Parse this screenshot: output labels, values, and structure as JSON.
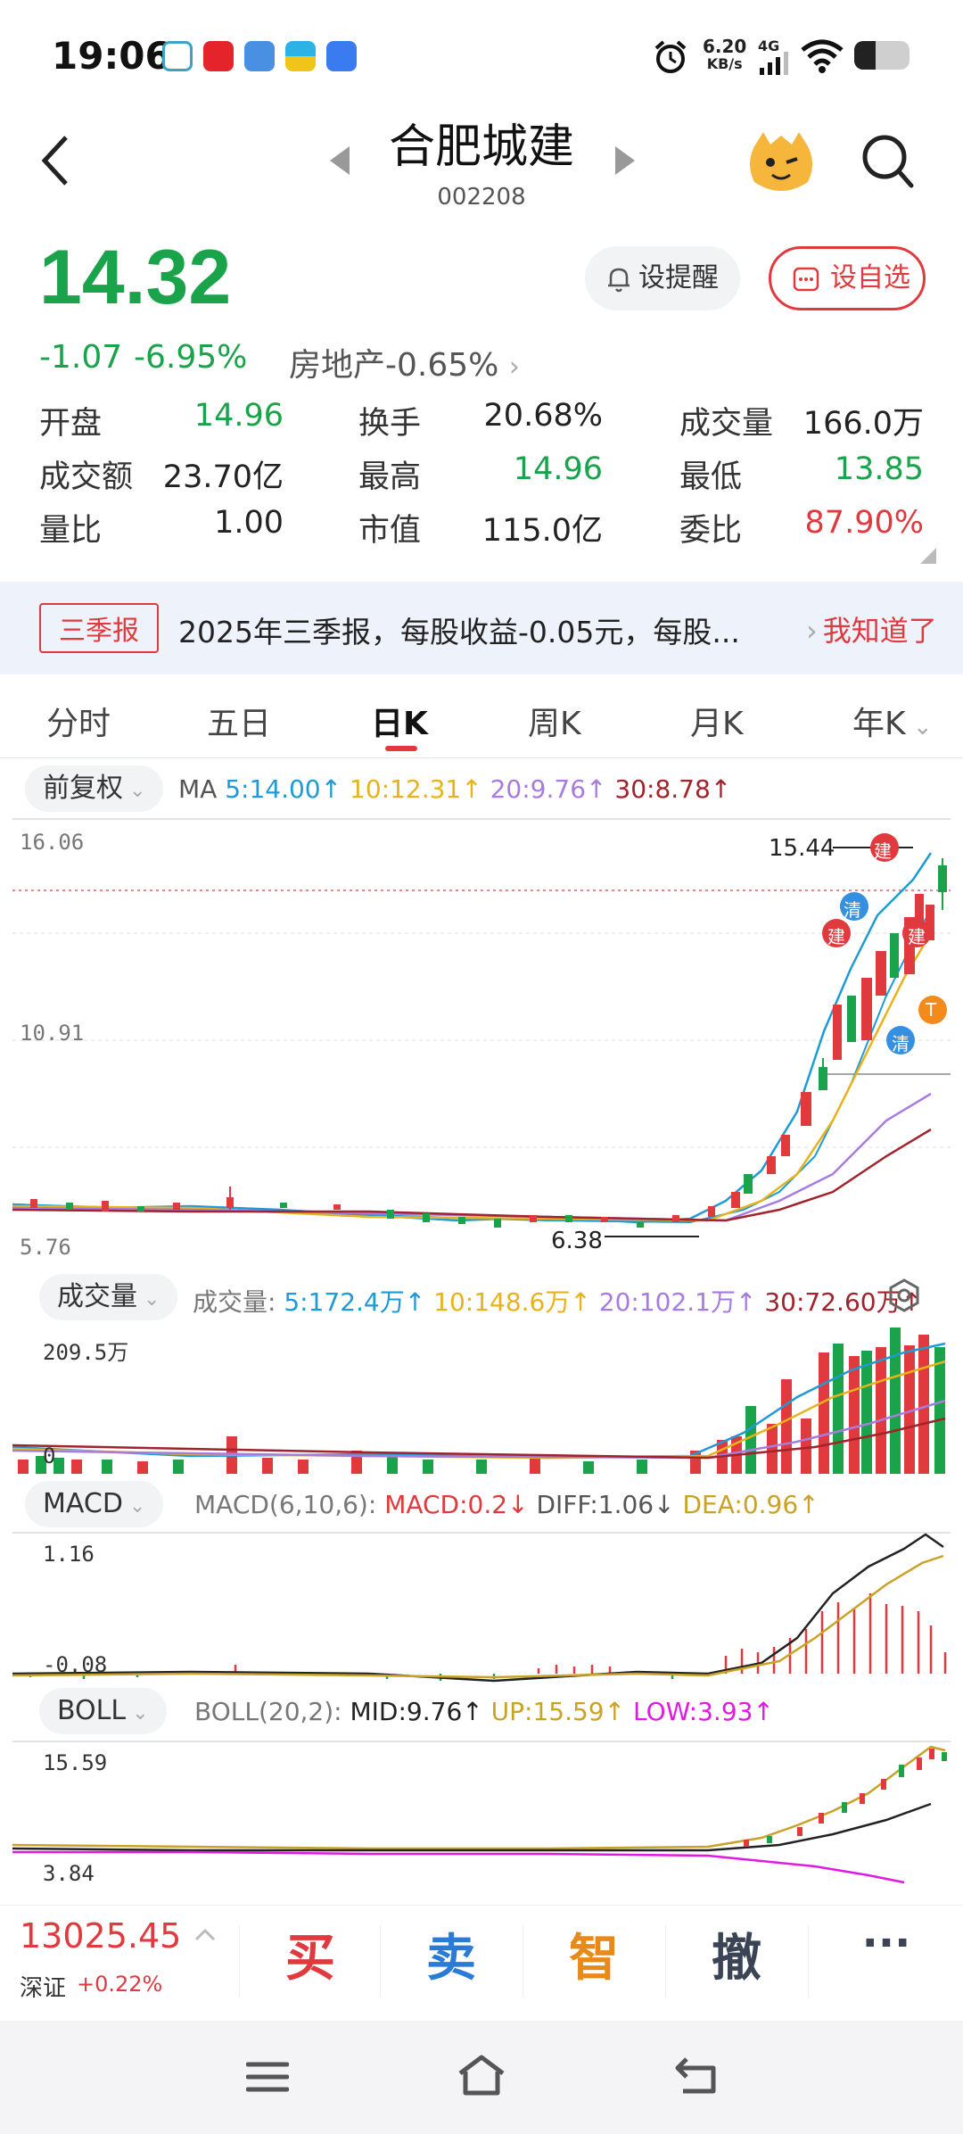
{
  "status_bar": {
    "time": "19:06",
    "net_speed": "6.20",
    "net_unit": "KB/s",
    "net_type": "4G",
    "icons": [
      "alarm-icon",
      "signal-icon",
      "wifi-icon",
      "battery-icon"
    ]
  },
  "header": {
    "stock_name": "合肥城建",
    "stock_code": "002208"
  },
  "quote": {
    "price": "14.32",
    "change": "-1.07",
    "change_pct": "-6.95%",
    "sector": "房地产",
    "sector_pct": "-0.65%",
    "alert_label": "设提醒",
    "watch_label": "设自选"
  },
  "stats": [
    {
      "label": "开盘",
      "value": "14.96",
      "color": "green"
    },
    {
      "label": "换手",
      "value": "20.68%",
      "color": "black"
    },
    {
      "label": "成交量",
      "value": "166.0万",
      "color": "black"
    },
    {
      "label": "成交额",
      "value": "23.70亿",
      "color": "black"
    },
    {
      "label": "最高",
      "value": "14.96",
      "color": "green"
    },
    {
      "label": "最低",
      "value": "13.85",
      "color": "green"
    },
    {
      "label": "量比",
      "value": "1.00",
      "color": "black"
    },
    {
      "label": "市值",
      "value": "115.0亿",
      "color": "black"
    },
    {
      "label": "委比",
      "value": "87.90%",
      "color": "red"
    }
  ],
  "notice": {
    "tag": "三季报",
    "text": "2025年三季报，每股收益-0.05元，每股...",
    "action": "我知道了"
  },
  "tabs": [
    "分时",
    "五日",
    "日K",
    "周K",
    "月K",
    "年K"
  ],
  "active_tab": "日K",
  "kline": {
    "adjust_label": "前复权",
    "ma_label": "MA",
    "ma5": "5:14.00",
    "ma10": "10:12.31",
    "ma20": "20:9.76",
    "ma30": "30:8.78",
    "axis_top": "16.06",
    "axis_mid": "10.91",
    "axis_bottom": "5.76",
    "high_mark": "15.44",
    "low_mark": "6.38",
    "markers": [
      "建",
      "清",
      "建",
      "建",
      "清",
      "T"
    ]
  },
  "volume": {
    "label": "成交量",
    "prefix": "成交量:",
    "v5": "5:172.4万",
    "v10": "10:148.6万",
    "v20": "20:102.1万",
    "v30": "30:72.60万",
    "axis_top": "209.5万",
    "axis_zero": "0"
  },
  "macd": {
    "label": "MACD",
    "params": "MACD(6,10,6):",
    "macd": "MACD:0.2",
    "diff": "DIFF:1.06",
    "dea": "DEA:0.96",
    "axis_top": "1.16",
    "axis_bottom": "-0.08"
  },
  "boll": {
    "label": "BOLL",
    "params": "BOLL(20,2):",
    "mid": "MID:9.76",
    "up": "UP:15.59",
    "low": "LOW:3.93",
    "axis_top": "15.59",
    "axis_bottom": "3.84"
  },
  "index": {
    "value": "13025.45",
    "name": "深证",
    "pct": "+0.22%"
  },
  "actions": [
    "买",
    "卖",
    "智",
    "撤",
    "···"
  ],
  "colors": {
    "up": "#e03a3e",
    "down": "#1aa34a",
    "ma5": "#1e9bd7",
    "ma10": "#e8b21a",
    "ma20": "#a77be0",
    "ma30": "#a1232b"
  }
}
